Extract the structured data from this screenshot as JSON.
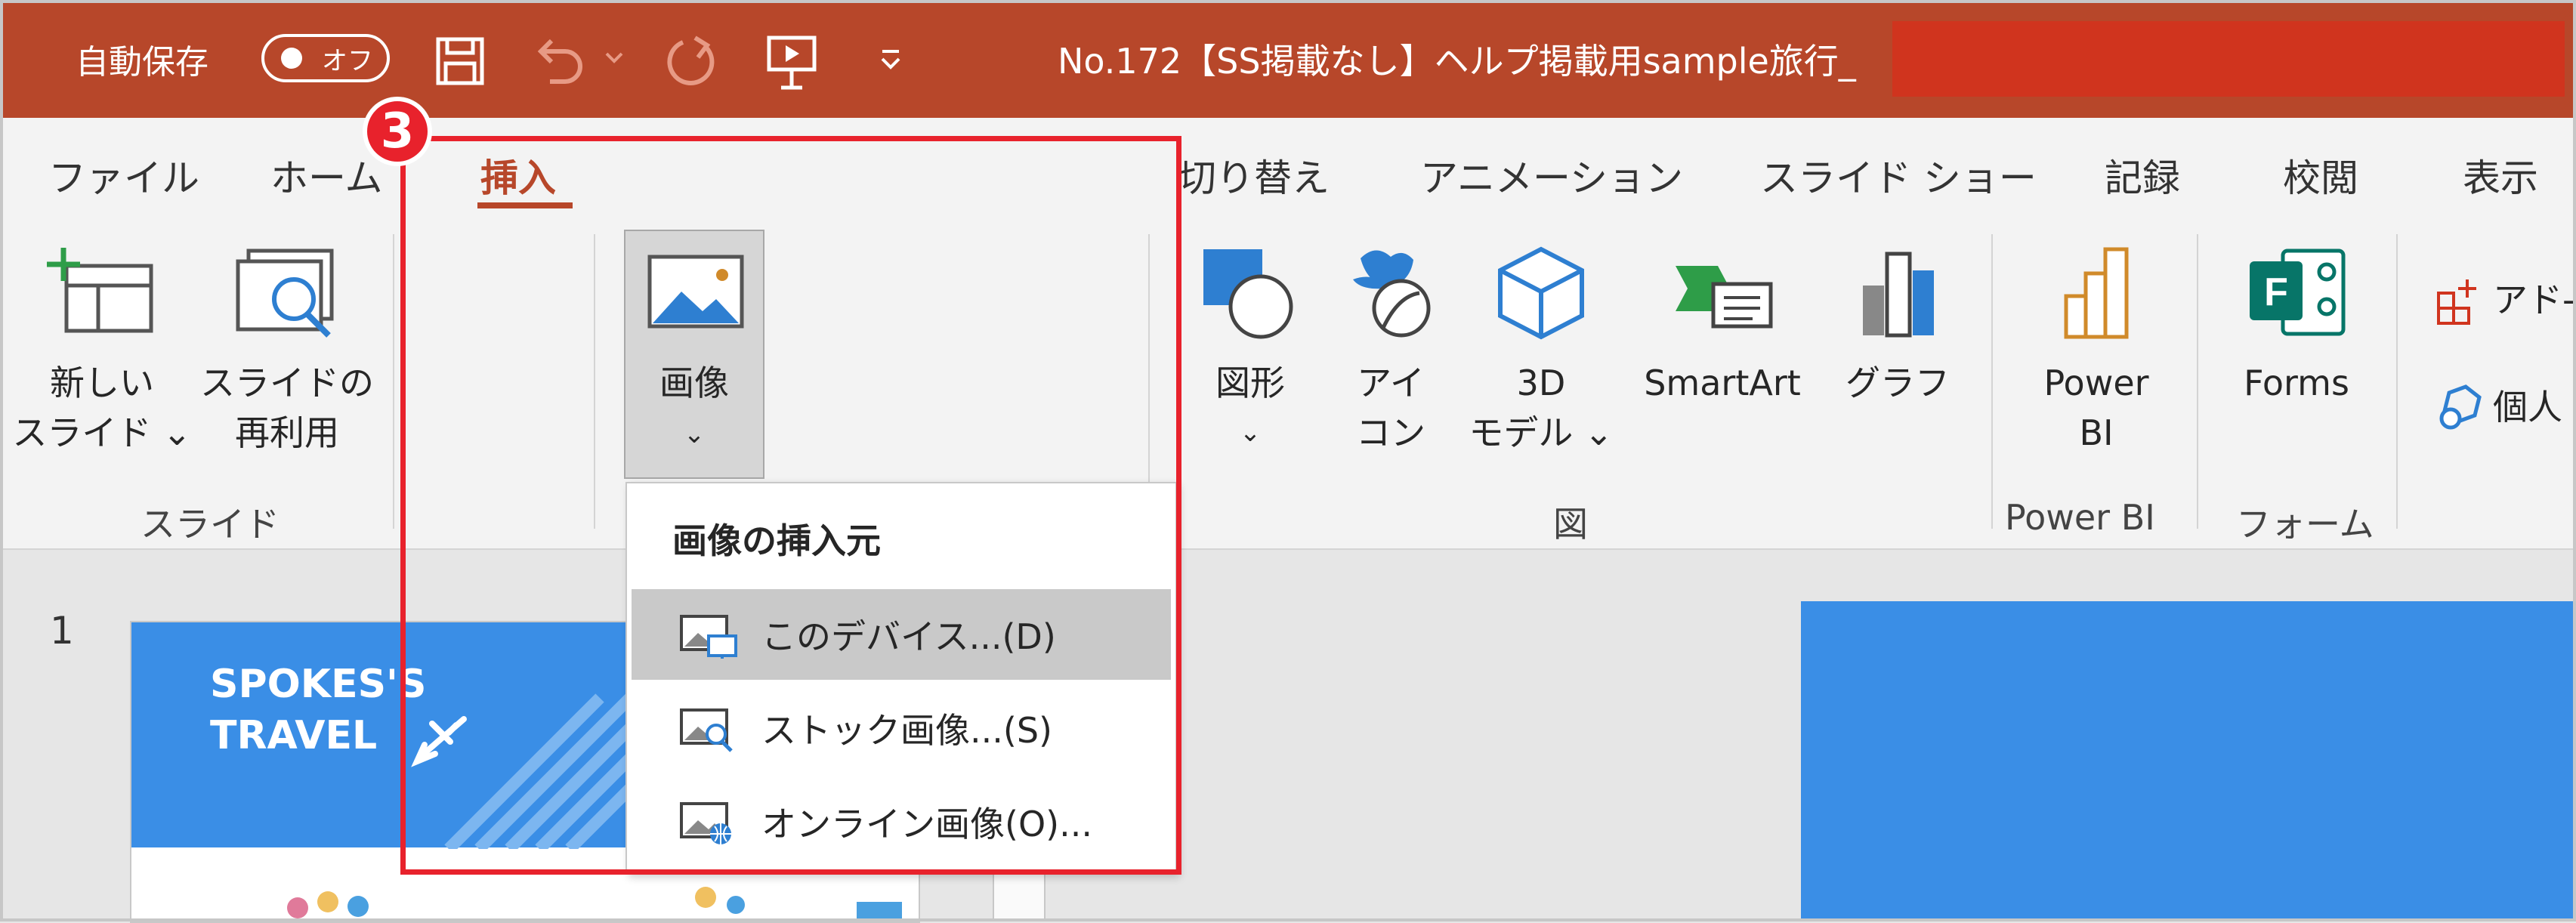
{
  "titlebar": {
    "autosave_label": "自動保存",
    "autosave_toggle": "オフ",
    "doc_title": "No.172【SS掲載なし】ヘルプ掲載用sample旅行_",
    "bg_color": "#b7472a"
  },
  "tabs": [
    {
      "label": "ファイル"
    },
    {
      "label": "ホーム"
    },
    {
      "label": "挿入"
    },
    {
      "label": "切り替え"
    },
    {
      "label": "アニメーション"
    },
    {
      "label": "スライド ショー"
    },
    {
      "label": "記録"
    },
    {
      "label": "校閲"
    },
    {
      "label": "表示"
    }
  ],
  "ribbon": {
    "new_slide": {
      "line1": "新しい",
      "line2": "スライド ⌄"
    },
    "reuse_slide": {
      "line1": "スライドの",
      "line2": "再利用"
    },
    "slides_group": "スライド",
    "image": {
      "label": "画像",
      "chevron": "⌄"
    },
    "shapes": {
      "line1": "図形",
      "line2": "⌄"
    },
    "icons": {
      "line1": "アイ",
      "line2": "コン"
    },
    "model3d": {
      "line1": "3D",
      "line2": "モデル ⌄"
    },
    "smartart": "SmartArt",
    "chart": "グラフ",
    "figures_group": "図",
    "powerbi": {
      "line1": "Power",
      "line2": "BI"
    },
    "powerbi_group": "Power BI",
    "forms": "Forms",
    "forms_group": "フォーム",
    "addin": "アド-",
    "personal": "個人"
  },
  "dropdown": {
    "header": "画像の挿入元",
    "items": [
      {
        "label": "このデバイス...(D)",
        "icon": "device-image-icon",
        "hover": true
      },
      {
        "label": "ストック画像...(S)",
        "icon": "stock-image-icon",
        "hover": false
      },
      {
        "label": "オンライン画像(O)...",
        "icon": "online-image-icon",
        "hover": false
      }
    ]
  },
  "step_badge": "3",
  "slide_panel": {
    "number": "1",
    "thumb_line1": "SPOKES'S",
    "thumb_line2": "TRAVEL"
  }
}
